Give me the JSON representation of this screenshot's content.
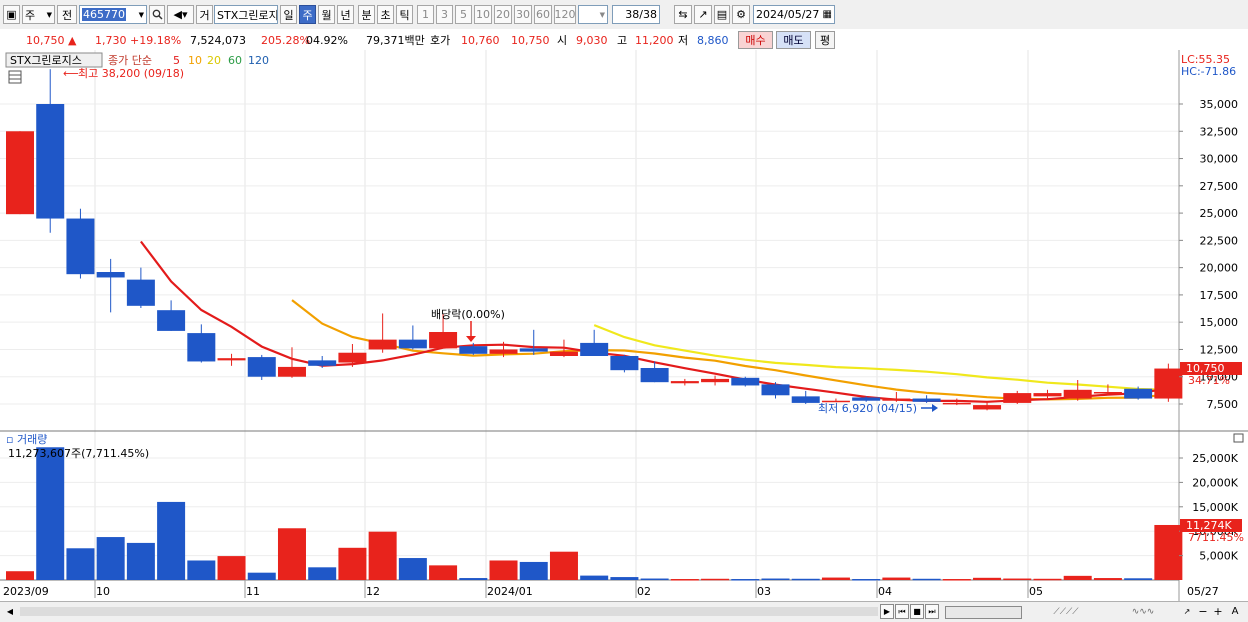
{
  "toolbar": {
    "period_unit": "주",
    "prev_label": "전",
    "code_value": "465770",
    "stock_name": "STX그린로지",
    "geo_label": "거",
    "periods": [
      "일",
      "주",
      "월",
      "년",
      "분",
      "초",
      "틱"
    ],
    "active_period": "주",
    "multipliers": [
      "1",
      "3",
      "5",
      "10",
      "20",
      "30",
      "60",
      "120"
    ],
    "count": "38/38",
    "date_value": "2024/05/27"
  },
  "quote": {
    "price": "10,750",
    "change": "1,730",
    "change_pct": "+19.18%",
    "volume": "7,524,073",
    "volume_ratio": "205.28%",
    "turnover": "04.92%",
    "amount": "79,371백만",
    "bid_label": "호가",
    "bid": "10,760",
    "ask": "10,750",
    "open_label": "시",
    "open": "9,030",
    "high_label": "고",
    "high": "11,200",
    "low_label": "저",
    "low": "8,860",
    "buy_label": "매수",
    "sell_label": "매도",
    "eval_label": "평"
  },
  "legend": {
    "name": "STX그린로지스",
    "ma_label": "종가 단순",
    "ma_periods": [
      "5",
      "10",
      "20",
      "60",
      "120"
    ],
    "lc": "LC:55.35",
    "hc": "HC:-71.86"
  },
  "annotations": {
    "high_marker": "최고 38,200 (09/18)",
    "low_marker": "최저 6,920 (04/15)",
    "dividend": "배당락(0.00%)",
    "last_price": "10,750",
    "last_pct": "34.71%"
  },
  "volume_panel": {
    "title": "거래량",
    "info": "11,273,607주(7,711.45%)",
    "last_vol": "11,274K",
    "last_pct": "7711.45%"
  },
  "colors": {
    "up": "#e8231c",
    "down": "#1f57c8",
    "ma5": "#e31b1b",
    "ma10": "#f2a000",
    "ma20": "#f0e81c",
    "ma60": "#2c9c46",
    "ma120": "#1f5fb0"
  },
  "chart_data": {
    "type": "candlestick",
    "price_axis": {
      "ticks": [
        "35,000",
        "32,500",
        "30,000",
        "27,500",
        "25,000",
        "22,500",
        "20,000",
        "17,500",
        "15,000",
        "12,500",
        "10,000",
        "7,500"
      ]
    },
    "volume_axis": {
      "ticks": [
        "25,000K",
        "20,000K",
        "15,000K",
        "10,000K",
        "5,000K"
      ]
    },
    "time_labels": [
      "2023/09",
      "10",
      "11",
      "12",
      "2024/01",
      "02",
      "03",
      "04",
      "05",
      "05/27"
    ],
    "candles": [
      {
        "o": 24900,
        "h": 32500,
        "l": 24900,
        "c": 32500,
        "v": 1800
      },
      {
        "o": 35000,
        "h": 38200,
        "l": 23200,
        "c": 24500,
        "v": 27200
      },
      {
        "o": 24500,
        "h": 25400,
        "l": 19000,
        "c": 19400,
        "v": 6500
      },
      {
        "o": 19600,
        "h": 20800,
        "l": 15900,
        "c": 19100,
        "v": 8800
      },
      {
        "o": 18900,
        "h": 20000,
        "l": 16300,
        "c": 16500,
        "v": 7600
      },
      {
        "o": 16100,
        "h": 17000,
        "l": 14200,
        "c": 14200,
        "v": 16000
      },
      {
        "o": 14000,
        "h": 14800,
        "l": 11300,
        "c": 11400,
        "v": 4000
      },
      {
        "o": 11500,
        "h": 12100,
        "l": 11000,
        "c": 11700,
        "v": 4900
      },
      {
        "o": 11800,
        "h": 12000,
        "l": 9700,
        "c": 10000,
        "v": 1500
      },
      {
        "o": 10000,
        "h": 12700,
        "l": 9900,
        "c": 10900,
        "v": 10600
      },
      {
        "o": 11500,
        "h": 11900,
        "l": 10800,
        "c": 11000,
        "v": 2600
      },
      {
        "o": 11300,
        "h": 13000,
        "l": 10900,
        "c": 12200,
        "v": 6600
      },
      {
        "o": 12500,
        "h": 15800,
        "l": 12200,
        "c": 13400,
        "v": 9900
      },
      {
        "o": 13400,
        "h": 14700,
        "l": 12500,
        "c": 12600,
        "v": 4500
      },
      {
        "o": 12600,
        "h": 15800,
        "l": 12600,
        "c": 14100,
        "v": 3000
      },
      {
        "o": 12800,
        "h": 13100,
        "l": 12000,
        "c": 12100,
        "v": 400
      },
      {
        "o": 12100,
        "h": 13200,
        "l": 11800,
        "c": 12500,
        "v": 4000
      },
      {
        "o": 12600,
        "h": 14300,
        "l": 12000,
        "c": 12300,
        "v": 3700
      },
      {
        "o": 11900,
        "h": 13400,
        "l": 11800,
        "c": 12300,
        "v": 5800
      },
      {
        "o": 13100,
        "h": 14300,
        "l": 11900,
        "c": 11900,
        "v": 900
      },
      {
        "o": 11900,
        "h": 12000,
        "l": 10400,
        "c": 10600,
        "v": 600
      },
      {
        "o": 10800,
        "h": 11400,
        "l": 9500,
        "c": 9500,
        "v": 300
      },
      {
        "o": 9400,
        "h": 9800,
        "l": 9200,
        "c": 9600,
        "v": 200
      },
      {
        "o": 9500,
        "h": 10100,
        "l": 9200,
        "c": 9800,
        "v": 250
      },
      {
        "o": 9900,
        "h": 10000,
        "l": 9100,
        "c": 9200,
        "v": 200
      },
      {
        "o": 9300,
        "h": 9500,
        "l": 8000,
        "c": 8300,
        "v": 300
      },
      {
        "o": 8200,
        "h": 8700,
        "l": 7500,
        "c": 7600,
        "v": 250
      },
      {
        "o": 7700,
        "h": 8000,
        "l": 7700,
        "c": 7800,
        "v": 500
      },
      {
        "o": 8100,
        "h": 8200,
        "l": 7700,
        "c": 7800,
        "v": 200
      },
      {
        "o": 7800,
        "h": 8600,
        "l": 7700,
        "c": 8000,
        "v": 500
      },
      {
        "o": 8000,
        "h": 8300,
        "l": 7600,
        "c": 7700,
        "v": 250
      },
      {
        "o": 7600,
        "h": 8000,
        "l": 7400,
        "c": 7600,
        "v": 200
      },
      {
        "o": 7000,
        "h": 7700,
        "l": 6920,
        "c": 7400,
        "v": 450
      },
      {
        "o": 7600,
        "h": 8700,
        "l": 7500,
        "c": 8500,
        "v": 300
      },
      {
        "o": 8200,
        "h": 8800,
        "l": 7900,
        "c": 8500,
        "v": 250
      },
      {
        "o": 8000,
        "h": 9700,
        "l": 7800,
        "c": 8800,
        "v": 850
      },
      {
        "o": 8600,
        "h": 9300,
        "l": 8300,
        "c": 8600,
        "v": 400
      },
      {
        "o": 8900,
        "h": 9100,
        "l": 7900,
        "c": 8000,
        "v": 350
      },
      {
        "o": 8000,
        "h": 11200,
        "l": 7700,
        "c": 10750,
        "v": 11274
      }
    ]
  }
}
